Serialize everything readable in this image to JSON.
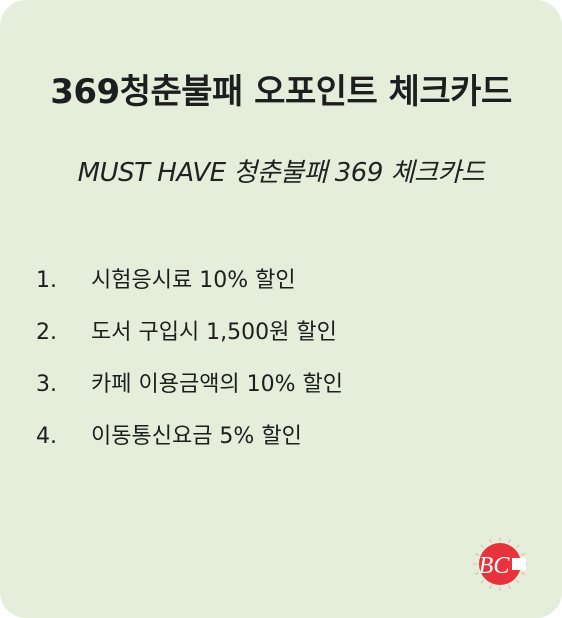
{
  "card": {
    "title": "369청춘불패 오포인트 체크카드",
    "subtitle": "MUST HAVE 청춘불패 369 체크카드",
    "benefits": [
      {
        "num": "1.",
        "text": "시험응시료 10% 할인"
      },
      {
        "num": "2.",
        "text": "도서 구입시 1,500원 할인"
      },
      {
        "num": "3.",
        "text": "카페 이용금액의 10% 할인"
      },
      {
        "num": "4.",
        "text": "이동통신요금 5% 할인"
      }
    ],
    "logo_text": "BC",
    "colors": {
      "background": "#e4eedb",
      "text": "#1e1e1e",
      "logo_red": "#e8323c"
    }
  }
}
